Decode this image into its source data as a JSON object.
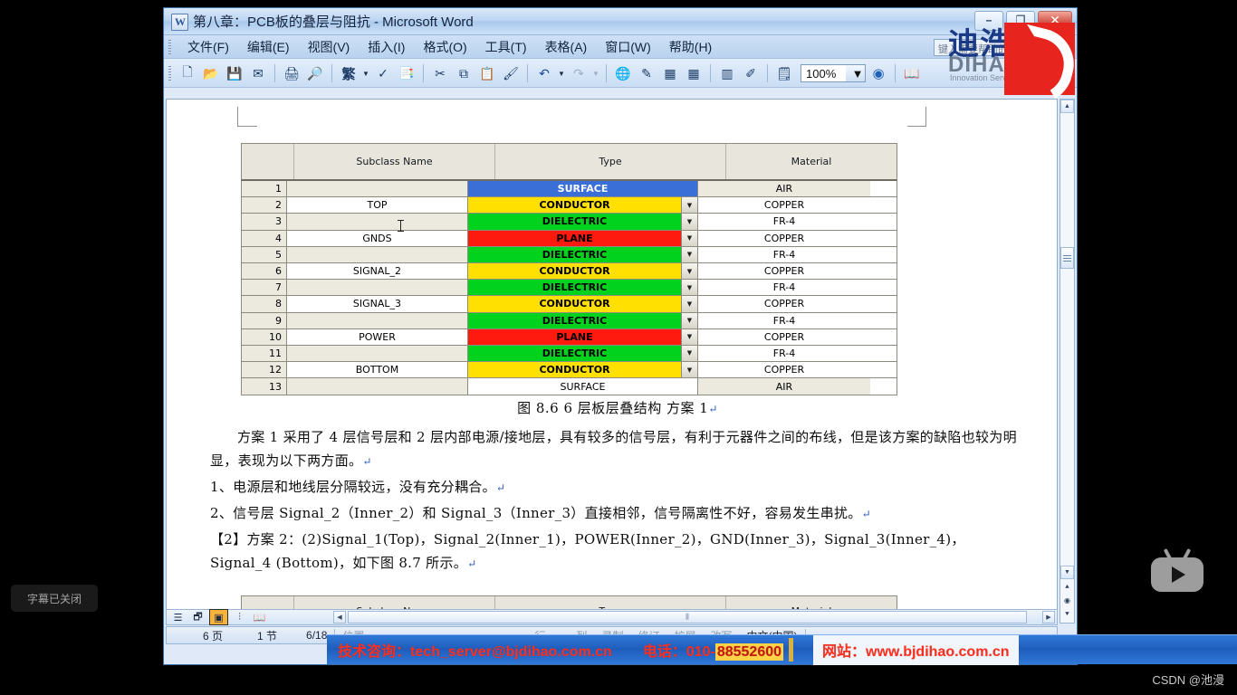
{
  "window": {
    "title": "第八章：PCB板的叠层与阻抗 - Microsoft Word",
    "app_icon": "word-document-icon",
    "minimize_label": "–",
    "maximize_label": "❐",
    "close_label": "✕"
  },
  "menu": {
    "items": [
      {
        "label": "文件(F)"
      },
      {
        "label": "编辑(E)"
      },
      {
        "label": "视图(V)"
      },
      {
        "label": "插入(I)"
      },
      {
        "label": "格式(O)"
      },
      {
        "label": "工具(T)"
      },
      {
        "label": "表格(A)"
      },
      {
        "label": "窗口(W)"
      },
      {
        "label": "帮助(H)"
      }
    ],
    "help_box_placeholder": "键入需要帮助的问题"
  },
  "toolbar": {
    "buttons": [
      {
        "name": "new-document-icon",
        "glyph": "🗋"
      },
      {
        "name": "open-folder-icon",
        "glyph": "📂"
      },
      {
        "name": "save-icon",
        "glyph": "💾"
      },
      {
        "name": "mail-recipient-icon",
        "glyph": "📧"
      },
      {
        "name": "print-icon",
        "glyph": "🖶"
      },
      {
        "name": "print-preview-icon",
        "glyph": "🔍"
      },
      {
        "name": "traditional-chinese-icon",
        "glyph": "繁"
      },
      {
        "name": "spelling-check-icon",
        "glyph": "拼"
      },
      {
        "name": "research-icon",
        "glyph": "📖"
      },
      {
        "name": "cut-icon",
        "glyph": "✂"
      },
      {
        "name": "copy-icon",
        "glyph": "⧉"
      },
      {
        "name": "paste-icon",
        "glyph": "📋"
      },
      {
        "name": "format-painter-icon",
        "glyph": "🖌"
      },
      {
        "name": "undo-icon",
        "glyph": "↶"
      },
      {
        "name": "redo-icon",
        "glyph": "↷"
      },
      {
        "name": "insert-hyperlink-icon",
        "glyph": "🌐"
      },
      {
        "name": "tables-and-borders-icon",
        "glyph": "▦"
      },
      {
        "name": "insert-table-icon",
        "glyph": "▤"
      },
      {
        "name": "insert-excel-sheet-icon",
        "glyph": "⊞"
      },
      {
        "name": "columns-icon",
        "glyph": "▥"
      },
      {
        "name": "drawing-icon",
        "glyph": "✎"
      },
      {
        "name": "document-map-icon",
        "glyph": "🗺"
      }
    ],
    "zoom_value": "100%",
    "help_icon": "?",
    "reading_layout_icon": "📖"
  },
  "logo": {
    "cn": "迪浩",
    "en": "DIHAO",
    "sub": "Innovation Services"
  },
  "document": {
    "stackup_table": {
      "headers": [
        "",
        "Subclass Name",
        "Type",
        "Material"
      ],
      "rows": [
        {
          "num": "1",
          "subclass": "",
          "type": "SURFACE",
          "type_style": "surface",
          "material": "AIR",
          "dropdown": false
        },
        {
          "num": "2",
          "subclass": "TOP",
          "type": "CONDUCTOR",
          "type_style": "cond",
          "material": "COPPER",
          "dropdown": true
        },
        {
          "num": "3",
          "subclass": "",
          "type": "DIELECTRIC",
          "type_style": "diel",
          "material": "FR-4",
          "dropdown": true
        },
        {
          "num": "4",
          "subclass": "GNDS",
          "type": "PLANE",
          "type_style": "plane",
          "material": "COPPER",
          "dropdown": true
        },
        {
          "num": "5",
          "subclass": "",
          "type": "DIELECTRIC",
          "type_style": "diel",
          "material": "FR-4",
          "dropdown": true
        },
        {
          "num": "6",
          "subclass": "SIGNAL_2",
          "type": "CONDUCTOR",
          "type_style": "cond",
          "material": "COPPER",
          "dropdown": true
        },
        {
          "num": "7",
          "subclass": "",
          "type": "DIELECTRIC",
          "type_style": "diel",
          "material": "FR-4",
          "dropdown": true
        },
        {
          "num": "8",
          "subclass": "SIGNAL_3",
          "type": "CONDUCTOR",
          "type_style": "cond",
          "material": "COPPER",
          "dropdown": true
        },
        {
          "num": "9",
          "subclass": "",
          "type": "DIELECTRIC",
          "type_style": "diel",
          "material": "FR-4",
          "dropdown": true
        },
        {
          "num": "10",
          "subclass": "POWER",
          "type": "PLANE",
          "type_style": "plane",
          "material": "COPPER",
          "dropdown": true
        },
        {
          "num": "11",
          "subclass": "",
          "type": "DIELECTRIC",
          "type_style": "diel",
          "material": "FR-4",
          "dropdown": true
        },
        {
          "num": "12",
          "subclass": "BOTTOM",
          "type": "CONDUCTOR",
          "type_style": "cond",
          "material": "COPPER",
          "dropdown": true
        },
        {
          "num": "13",
          "subclass": "",
          "type": "SURFACE",
          "type_style": "plain",
          "material": "AIR",
          "dropdown": false
        }
      ]
    },
    "figure_caption": "图 8.6 6 层板层叠结构 方案 1",
    "paragraphs": [
      "方案 1 采用了 4 层信号层和 2 层内部电源/接地层，具有较多的信号层，有利于元器件之间的布线，但是该方案的缺陷也较为明显，表现为以下两方面。",
      "1、电源层和地线层分隔较远，没有充分耦合。",
      "2、信号层 Signal_2（Inner_2）和 Signal_3（Inner_3）直接相邻，信号隔离性不好，容易发生串扰。",
      "【2】方案 2：(2)Signal_1(Top)，Signal_2(Inner_1)，POWER(Inner_2)，GND(Inner_3)，Signal_3(Inner_4)，Signal_4 (Bottom)，如下图 8.7 所示。"
    ],
    "second_table_headers": [
      "",
      "Subclass Name",
      "Type",
      "Material"
    ]
  },
  "view_bar": {
    "buttons": [
      {
        "name": "normal-view-button",
        "glyph": "▤"
      },
      {
        "name": "web-layout-view-button",
        "glyph": "🗗"
      },
      {
        "name": "print-layout-view-button",
        "glyph": "▣"
      },
      {
        "name": "outline-view-button",
        "glyph": "▤"
      },
      {
        "name": "reading-layout-view-button",
        "glyph": "📖"
      }
    ]
  },
  "status_bar": {
    "page": "6 页",
    "section": "1 节",
    "page_of": "6/18",
    "position": "位置",
    "line": "行",
    "column": "列",
    "rec": "录制",
    "trk": "修订",
    "ext": "扩展",
    "ovr": "改写",
    "language": "中文(中国)"
  },
  "banner": {
    "support": "技术咨询：tech_server@bjdihao.com.cn",
    "phone_label": "电话：010-",
    "phone_number": "88552600",
    "website": "网站：www.bjdihao.com.cn"
  },
  "overlay": {
    "caption_badge": "字幕已关闭",
    "watermark": "CSDN @池漫",
    "play_icon": "video-play-icon"
  },
  "colors": {
    "surface": "#3a6fd8",
    "conductor": "#ffe000",
    "dielectric": "#00d21e",
    "plane": "#fe1a0e",
    "banner_blue": "#1f5dbb",
    "banner_red": "#ff2f20",
    "brand_red": "#e8241f"
  }
}
